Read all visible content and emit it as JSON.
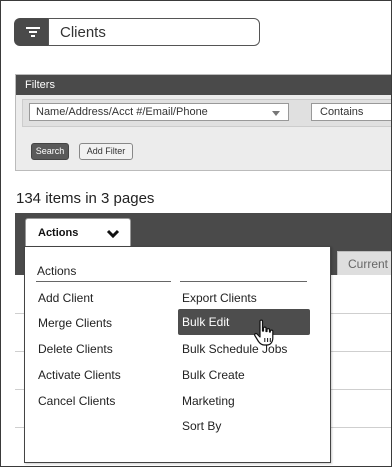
{
  "header": {
    "title": "Clients",
    "menu_icon": "filter-lines-icon"
  },
  "filters": {
    "heading": "Filters",
    "field_select": "Name/Address/Acct #/Email/Phone",
    "operator_select": "Contains",
    "search_label": "Search",
    "add_filter_label": "Add Filter"
  },
  "summary": {
    "count_text": "134 items in 3 pages"
  },
  "tabs": {
    "actions_label": "Actions",
    "current_label": "Current"
  },
  "dropdown": {
    "left_heading": "Actions",
    "left_items": [
      "Add Client",
      "Merge Clients",
      "Delete Clients",
      "Activate Clients",
      "Cancel Clients"
    ],
    "right_items": [
      "Export Clients",
      "Bulk Edit",
      "Bulk Schedule Jobs",
      "Bulk Create",
      "Marketing",
      "Sort By"
    ],
    "highlighted": "Bulk Edit"
  }
}
